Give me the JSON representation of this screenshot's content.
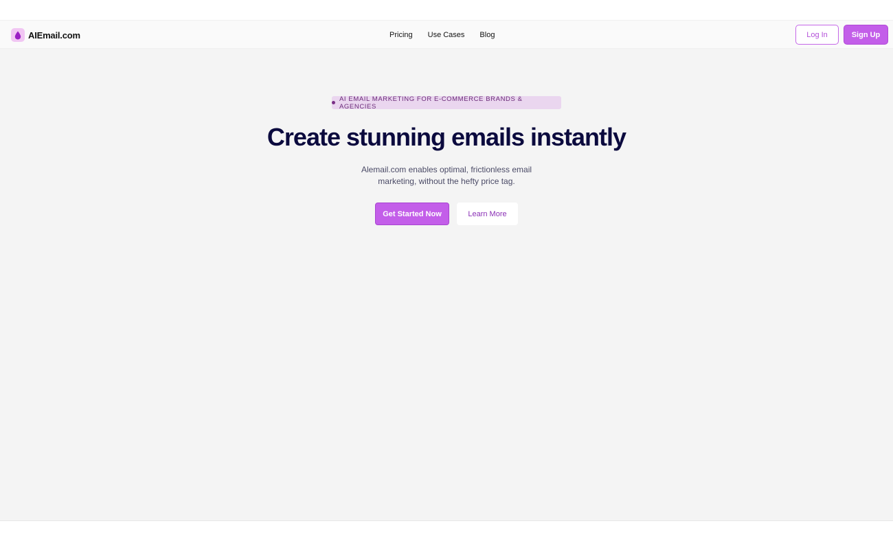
{
  "nav": {
    "logo_text": "AIEmail.com",
    "logo_icon": "droplet-icon",
    "links": [
      {
        "label": "Pricing"
      },
      {
        "label": "Use Cases"
      },
      {
        "label": "Blog"
      }
    ],
    "login_label": "Log In",
    "signup_label": "Sign Up"
  },
  "hero": {
    "badge_text": "AI EMAIL MARKETING FOR E-COMMERCE BRANDS & AGENCIES",
    "headline": "Create stunning emails instantly",
    "subhead": "Alemail.com enables optimal, frictionless email marketing, without the hefty price tag.",
    "primary_cta": "Get Started Now",
    "secondary_cta": "Learn More"
  },
  "colors": {
    "accent": "#c35ee9",
    "headline": "#0b0a3e",
    "hero_bg": "#f4f4f4",
    "badge_bg": "#ead6ef"
  }
}
